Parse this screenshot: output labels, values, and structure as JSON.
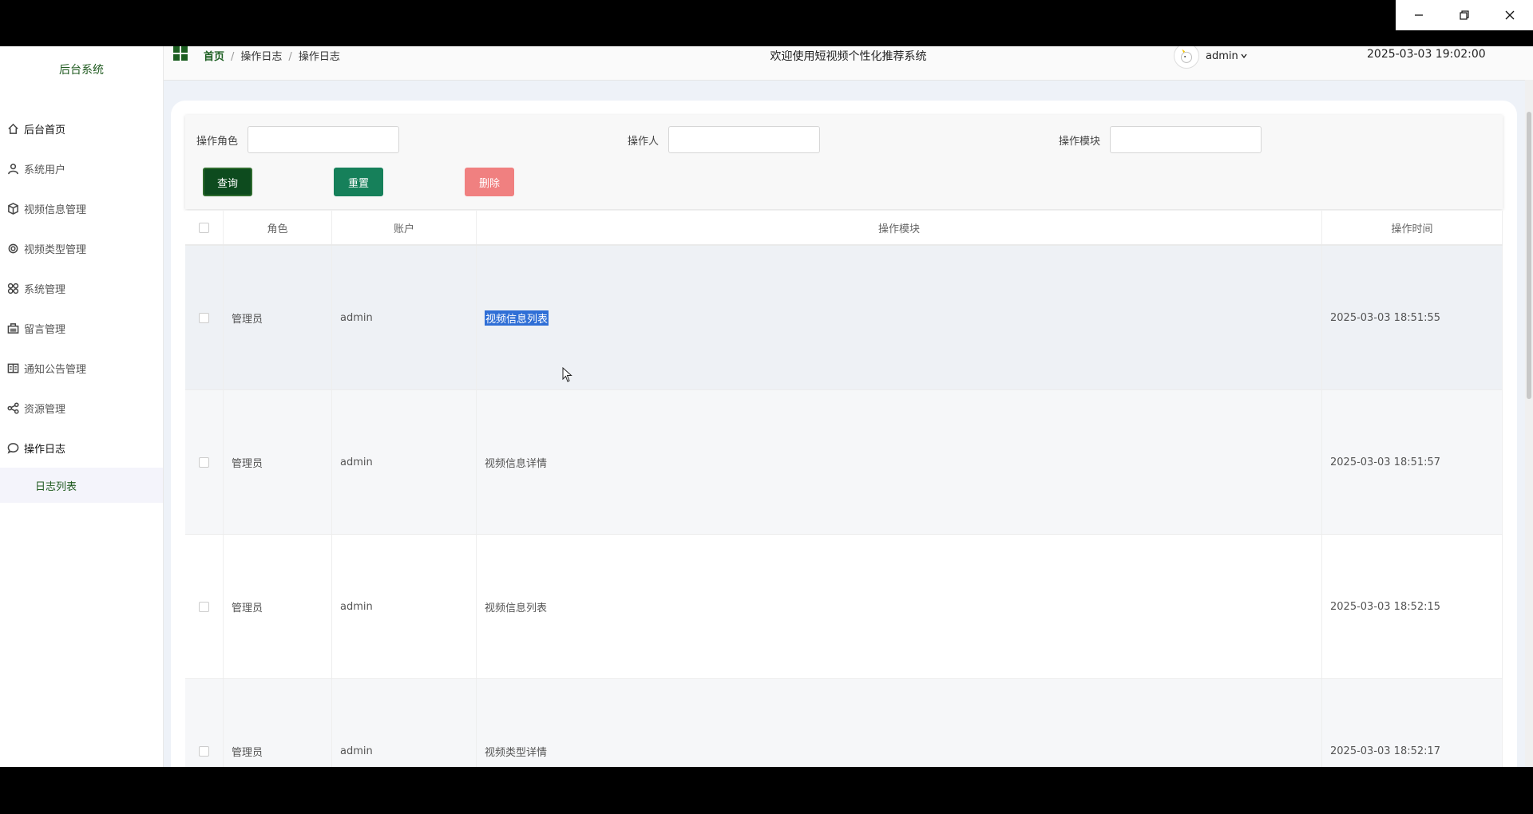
{
  "window": {
    "minimize": "—",
    "restore": "❐",
    "close": "✕"
  },
  "sidebar": {
    "brand": "后台系统",
    "items": [
      {
        "label": "后台首页",
        "icon": "home-icon"
      },
      {
        "label": "系统用户",
        "icon": "user-icon"
      },
      {
        "label": "视频信息管理",
        "icon": "cube-icon"
      },
      {
        "label": "视频类型管理",
        "icon": "gear-icon"
      },
      {
        "label": "系统管理",
        "icon": "grid-icon"
      },
      {
        "label": "留言管理",
        "icon": "message-box-icon"
      },
      {
        "label": "通知公告管理",
        "icon": "book-icon"
      },
      {
        "label": "资源管理",
        "icon": "share-icon"
      },
      {
        "label": "操作日志",
        "icon": "chat-icon"
      }
    ],
    "submenu": [
      {
        "label": "日志列表"
      }
    ]
  },
  "header": {
    "breadcrumb": [
      "首页",
      "操作日志",
      "操作日志"
    ],
    "welcome": "欢迎使用短视频个性化推荐系统",
    "user": "admin",
    "datetime": "2025-03-03 19:02:00"
  },
  "search": {
    "role_label": "操作角色",
    "role_value": "",
    "operator_label": "操作人",
    "operator_value": "",
    "module_label": "操作模块",
    "module_value": "",
    "query_label": "查询",
    "reset_label": "重置",
    "delete_label": "删除"
  },
  "table": {
    "columns": [
      "角色",
      "账户",
      "操作模块",
      "操作时间"
    ],
    "rows": [
      {
        "role": "管理员",
        "account": "admin",
        "module": "视频信息列表",
        "time": "2025-03-03 18:51:55"
      },
      {
        "role": "管理员",
        "account": "admin",
        "module": "视频信息详情",
        "time": "2025-03-03 18:51:57"
      },
      {
        "role": "管理员",
        "account": "admin",
        "module": "视频信息列表",
        "time": "2025-03-03 18:52:15"
      },
      {
        "role": "管理员",
        "account": "admin",
        "module": "视频类型详情",
        "time": "2025-03-03 18:52:17"
      }
    ]
  },
  "colors": {
    "accent": "#1b5e20",
    "query_btn": "#0d4b1e",
    "reset_btn": "#16805a",
    "delete_btn": "#f08080"
  }
}
